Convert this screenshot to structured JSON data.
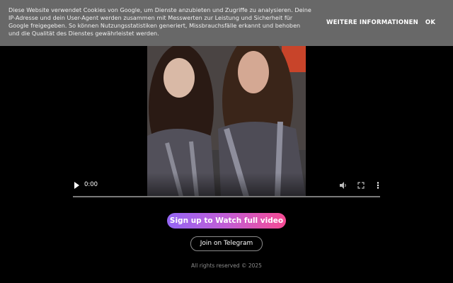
{
  "cookie_banner": {
    "text": "Diese Website verwendet Cookies von Google, um Dienste anzubieten und Zugriffe zu analysieren. Deine IP-Adresse und dein User-Agent werden zusammen mit Messwerten zur Leistung und Sicherheit für Google freigegeben. So können Nutzungsstatistiken generiert, Missbrauchsfälle erkannt und behoben und die Qualität des Dienstes gewährleistet werden.",
    "more_info_label": "WEITERE INFORMATIONEN",
    "ok_label": "OK"
  },
  "video": {
    "time": "0:00",
    "icons": [
      "play-icon",
      "volume-icon",
      "fullscreen-icon",
      "more-vertical-icon"
    ],
    "progress": 0
  },
  "actions": {
    "signup_label": "Sign up to Watch full video",
    "telegram_label": "Join on Telegram"
  },
  "footer": {
    "text": "All rights reserved © 2025"
  },
  "colors": {
    "cookie_bg": "#686868",
    "page_bg": "#000000",
    "signup_gradient_start": "#9466f5",
    "signup_gradient_end": "#f64b93"
  }
}
